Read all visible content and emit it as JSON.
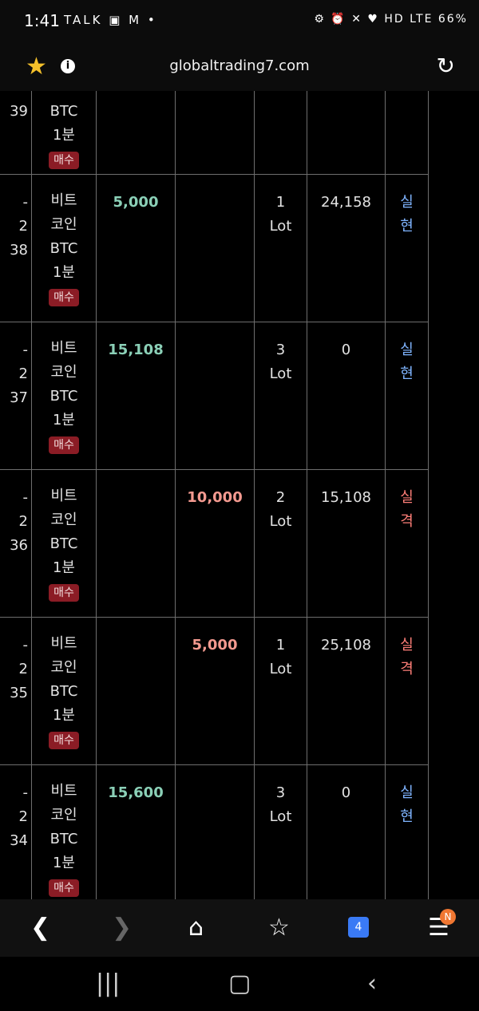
{
  "status": {
    "time": "1:41",
    "icons_left": "TALK ▣ M •",
    "icons_right": "⚙ ⏰ ✕ ♥ HD LTE 66%"
  },
  "browser": {
    "url": "globaltrading7.com"
  },
  "table": {
    "partial_row": {
      "id_suffix": "39",
      "product": [
        "BTC",
        "1분"
      ],
      "badge": "매수"
    },
    "rows": [
      {
        "prefix": "-",
        "mid": "2",
        "id_suffix": "38",
        "product": [
          "비트",
          "코인",
          "BTC",
          "1분"
        ],
        "badge": "매수",
        "profit": "5,000",
        "loss": "",
        "lots": [
          "1",
          "Lot"
        ],
        "balance": "24,158",
        "result": [
          "실",
          "현"
        ],
        "result_type": "realized"
      },
      {
        "prefix": "-",
        "mid": "2",
        "id_suffix": "37",
        "product": [
          "비트",
          "코인",
          "BTC",
          "1분"
        ],
        "badge": "매수",
        "profit": "15,108",
        "loss": "",
        "lots": [
          "3",
          "Lot"
        ],
        "balance": "0",
        "result": [
          "실",
          "현"
        ],
        "result_type": "realized"
      },
      {
        "prefix": "-",
        "mid": "2",
        "id_suffix": "36",
        "product": [
          "비트",
          "코인",
          "BTC",
          "1분"
        ],
        "badge": "매수",
        "profit": "",
        "loss": "10,000",
        "lots": [
          "2",
          "Lot"
        ],
        "balance": "15,108",
        "result": [
          "실",
          "격"
        ],
        "result_type": "lost"
      },
      {
        "prefix": "-",
        "mid": "2",
        "id_suffix": "35",
        "product": [
          "비트",
          "코인",
          "BTC",
          "1분"
        ],
        "badge": "매수",
        "profit": "",
        "loss": "5,000",
        "lots": [
          "1",
          "Lot"
        ],
        "balance": "25,108",
        "result": [
          "실",
          "격"
        ],
        "result_type": "lost"
      },
      {
        "prefix": "-",
        "mid": "2",
        "id_suffix": "34",
        "product": [
          "비트",
          "코인",
          "BTC",
          "1분"
        ],
        "badge": "매수",
        "profit": "15,600",
        "loss": "",
        "lots": [
          "3",
          "Lot"
        ],
        "balance": "0",
        "result": [
          "실",
          "현"
        ],
        "result_type": "realized"
      }
    ]
  },
  "bottom_nav": {
    "tab_count": "4",
    "menu_badge": "N"
  },
  "colors": {
    "profit": "#8bd0b7",
    "loss": "#f49a90",
    "badge_bg": "#8b1c25",
    "tabs_accent": "#3a7af5"
  }
}
